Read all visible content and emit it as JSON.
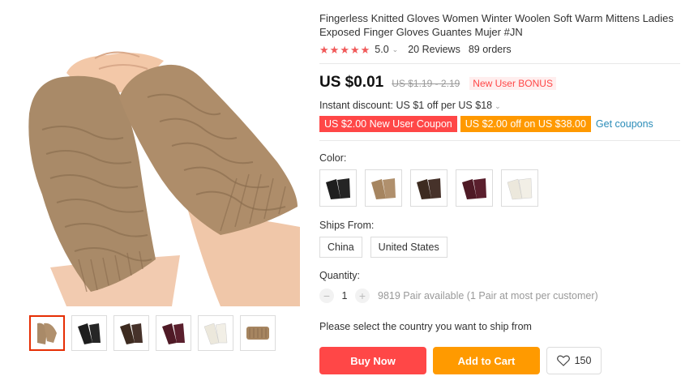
{
  "product": {
    "title": "Fingerless Knitted Gloves Women Winter Woolen Soft Warm Mittens Ladies Exposed Finger Gloves Guantes Mujer #JN",
    "rating": "5.0",
    "reviews": "20 Reviews",
    "orders": "89 orders"
  },
  "price": {
    "current": "US $0.01",
    "original": "US $1.19 - 2.19",
    "bonus": "New User BONUS"
  },
  "discount": {
    "text": "Instant discount: US $1 off per US $18"
  },
  "coupons": {
    "coupon1": "US $2.00 New User Coupon",
    "coupon2": "US $2.00 off on US $38.00",
    "link": "Get coupons"
  },
  "color": {
    "label": "Color:",
    "options": [
      "black",
      "camel",
      "coffee",
      "wine",
      "ivory"
    ],
    "colors": {
      "black": "#1e1e1e",
      "camel": "#a68560",
      "coffee": "#3d2b20",
      "wine": "#4f1a26",
      "ivory": "#efece2"
    }
  },
  "ships": {
    "label": "Ships From:",
    "options": [
      "China",
      "United States"
    ]
  },
  "quantity": {
    "label": "Quantity:",
    "value": "1",
    "available": "9819 Pair available (1 Pair at most per customer)"
  },
  "ship_note": "Please select the country you want to ship from",
  "actions": {
    "buy": "Buy Now",
    "cart": "Add to Cart",
    "wishlist_count": "150"
  },
  "theme": {
    "accent_red": "#ff4747",
    "accent_orange": "#ff9900",
    "link_blue": "#2a8cb8",
    "star": "#f15a5a"
  }
}
